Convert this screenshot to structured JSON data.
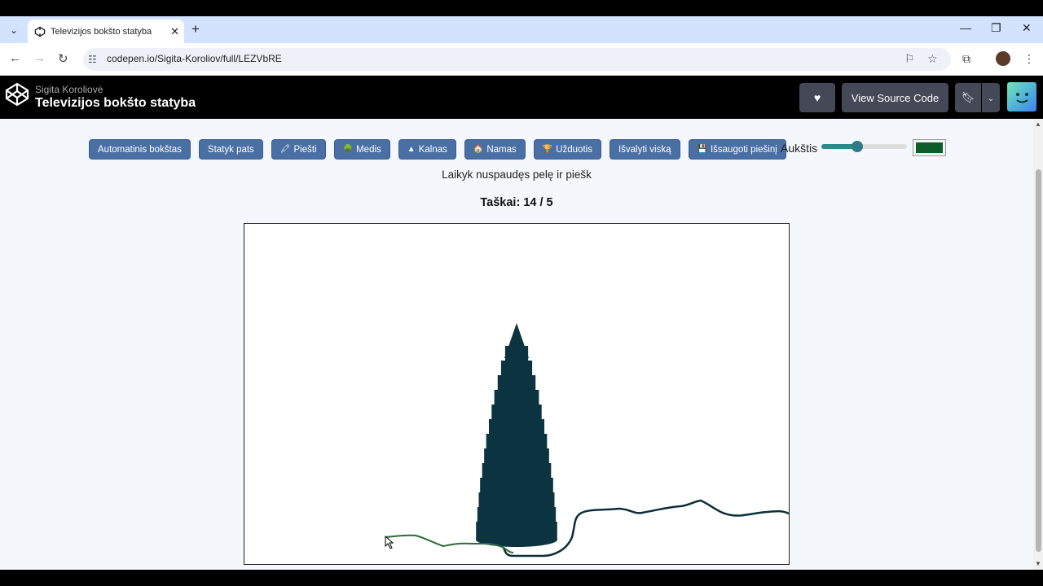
{
  "browser": {
    "tab_title": "Televizijos bokšto statyba",
    "url": "codepen.io/Sigita-Koroliov/full/LEZVbRE"
  },
  "codepen": {
    "author": "Sigita Koroliovė",
    "title": "Televizijos bokšto statyba",
    "view_source_label": "View Source Code"
  },
  "toolbar": {
    "buttons": [
      {
        "label": "Automatinis bokštas",
        "icon": ""
      },
      {
        "label": "Statyk pats",
        "icon": ""
      },
      {
        "label": "Piešti",
        "icon": "🖍"
      },
      {
        "label": "Medis",
        "icon": "🌳"
      },
      {
        "label": "Kalnas",
        "icon": "▲"
      },
      {
        "label": "Namas",
        "icon": "🏠"
      },
      {
        "label": "Užduotis",
        "icon": "🏆"
      },
      {
        "label": "Išvalyti viską",
        "icon": ""
      },
      {
        "label": "Išsaugoti piešinį",
        "icon": "💾"
      }
    ],
    "height_label": "Aukštis",
    "height_value": 0.42,
    "color_value": "#0e5c2a"
  },
  "instruction": "Laikyk nuspaudęs pelę ir piešk",
  "score": "Taškai: 14 / 5",
  "colors": {
    "tower": "#0b3440",
    "ground_line": "#0b2f38",
    "drawn_line": "#2e6b3a",
    "button": "#4a6fa5"
  }
}
